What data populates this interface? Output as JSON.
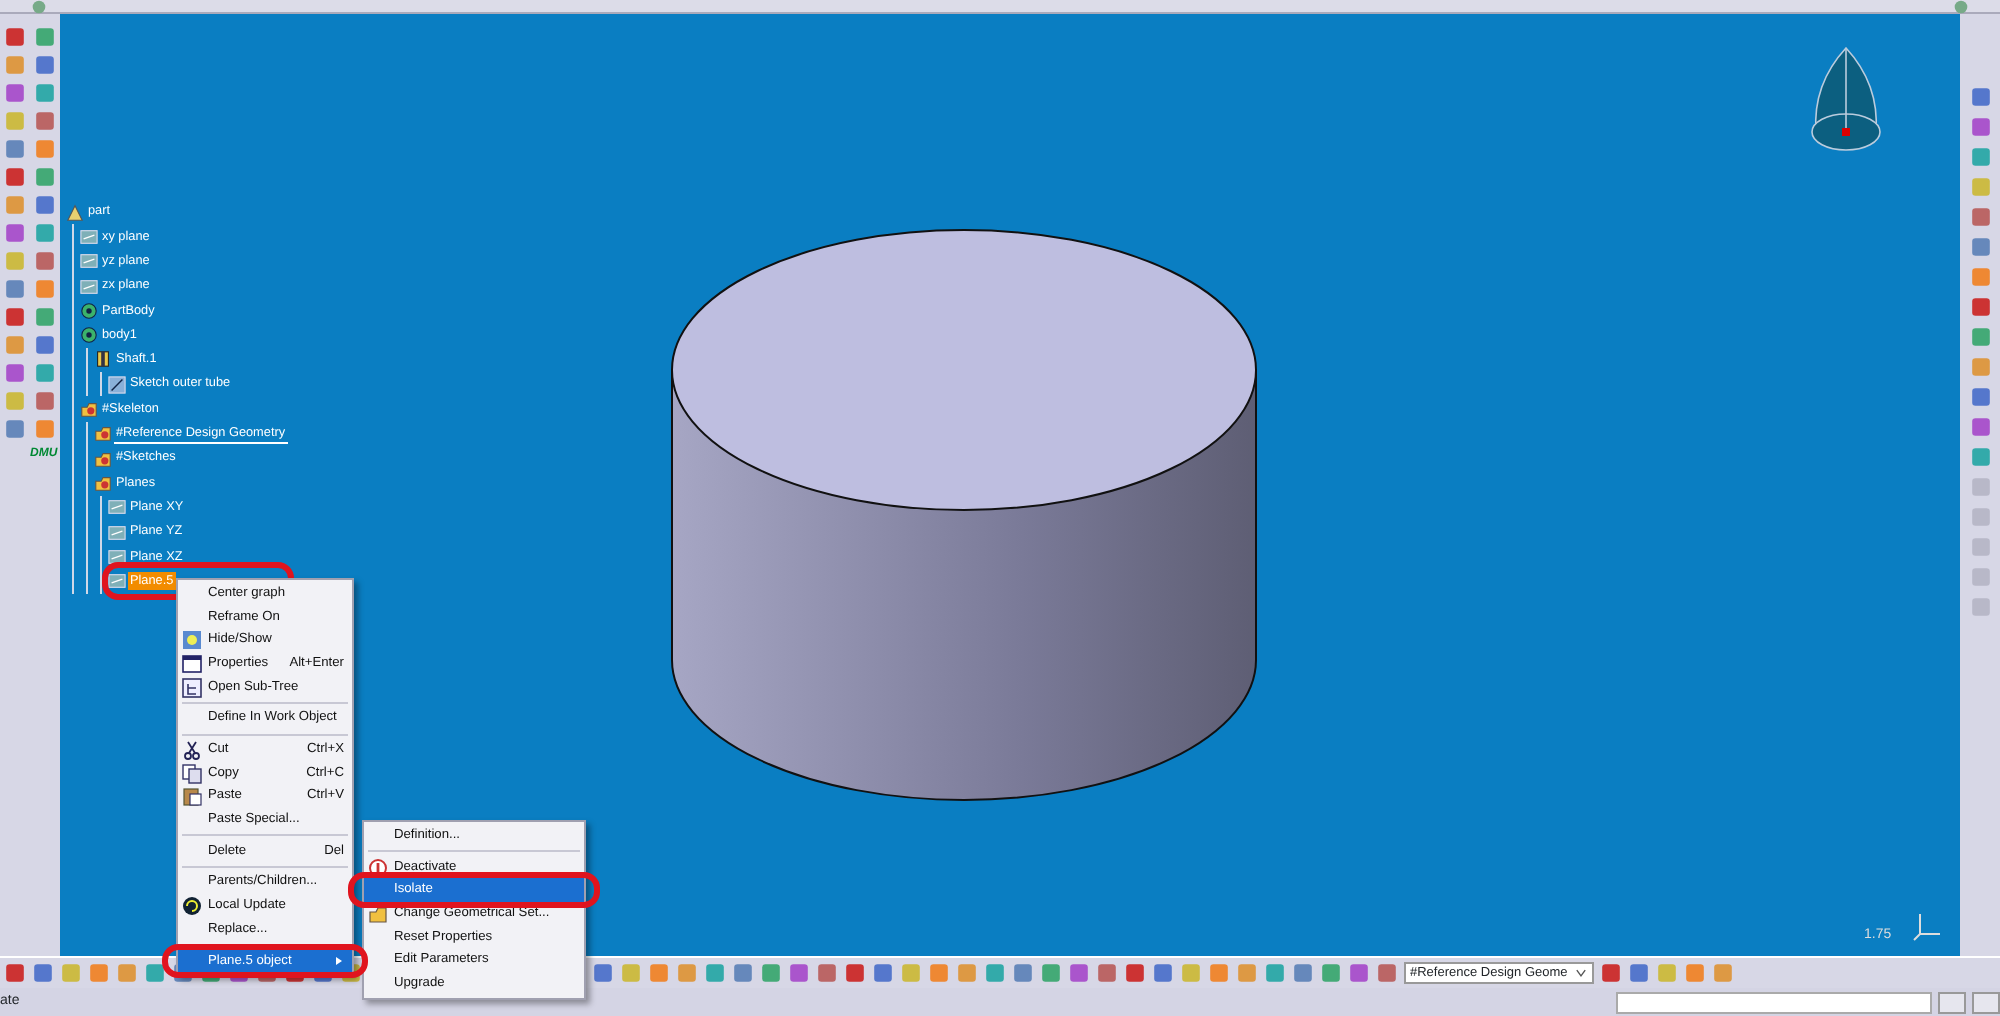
{
  "tree": [
    {
      "label": "part",
      "kind": "part",
      "selected": false,
      "highlight": false,
      "underlined": false,
      "children": [
        {
          "label": "xy plane",
          "kind": "plane",
          "selected": false,
          "highlight": false,
          "underlined": false
        },
        {
          "label": "yz plane",
          "kind": "plane",
          "selected": false,
          "highlight": false,
          "underlined": false
        },
        {
          "label": "zx plane",
          "kind": "plane",
          "selected": false,
          "highlight": false,
          "underlined": false
        },
        {
          "label": "PartBody",
          "kind": "body",
          "selected": false,
          "highlight": false,
          "underlined": false
        },
        {
          "label": "body1",
          "kind": "body",
          "selected": false,
          "highlight": false,
          "underlined": false,
          "children": [
            {
              "label": "Shaft.1",
              "kind": "feature",
              "selected": false,
              "highlight": false,
              "underlined": false,
              "children": [
                {
                  "label": "Sketch outer tube",
                  "kind": "sketch",
                  "selected": false,
                  "highlight": false,
                  "underlined": false
                }
              ]
            }
          ]
        },
        {
          "label": "#Skeleton",
          "kind": "set",
          "selected": false,
          "highlight": false,
          "underlined": false,
          "children": [
            {
              "label": "#Reference Design Geometry",
              "kind": "set",
              "selected": false,
              "highlight": false,
              "underlined": true
            },
            {
              "label": "#Sketches",
              "kind": "set",
              "selected": false,
              "highlight": false,
              "underlined": false
            },
            {
              "label": "Planes",
              "kind": "set",
              "selected": false,
              "highlight": false,
              "underlined": false,
              "children": [
                {
                  "label": "Plane XY",
                  "kind": "plane",
                  "selected": false,
                  "highlight": false,
                  "underlined": false
                },
                {
                  "label": "Plane YZ",
                  "kind": "plane",
                  "selected": false,
                  "highlight": false,
                  "underlined": false
                },
                {
                  "label": "Plane XZ",
                  "kind": "plane",
                  "selected": false,
                  "highlight": false,
                  "underlined": false
                },
                {
                  "label": "Plane.5",
                  "kind": "plane",
                  "selected": true,
                  "highlight": true,
                  "underlined": false
                }
              ]
            }
          ]
        }
      ]
    }
  ],
  "context_menu": [
    {
      "kind": "item",
      "label": "Center graph",
      "selected": false,
      "highlight": false
    },
    {
      "kind": "item",
      "label": "Reframe On",
      "selected": false,
      "highlight": false
    },
    {
      "kind": "hideshow",
      "label": "Hide/Show",
      "selected": false,
      "highlight": false
    },
    {
      "kind": "properties",
      "label": "Properties",
      "shortcut": "Alt+Enter",
      "selected": false,
      "highlight": false
    },
    {
      "kind": "subtree",
      "label": "Open Sub-Tree",
      "selected": false,
      "highlight": false
    },
    {
      "kind": "separator"
    },
    {
      "kind": "item",
      "label": "Define In Work Object",
      "selected": false,
      "highlight": false
    },
    {
      "kind": "separator"
    },
    {
      "kind": "cut",
      "label": "Cut",
      "shortcut": "Ctrl+X",
      "selected": false,
      "highlight": false
    },
    {
      "kind": "copy",
      "label": "Copy",
      "shortcut": "Ctrl+C",
      "selected": false,
      "highlight": false
    },
    {
      "kind": "paste",
      "label": "Paste",
      "shortcut": "Ctrl+V",
      "selected": false,
      "highlight": false
    },
    {
      "kind": "item",
      "label": "Paste Special...",
      "selected": false,
      "highlight": false
    },
    {
      "kind": "separator"
    },
    {
      "kind": "item",
      "label": "Delete",
      "shortcut": "Del",
      "selected": false,
      "highlight": false
    },
    {
      "kind": "separator"
    },
    {
      "kind": "item",
      "label": "Parents/Children...",
      "selected": false,
      "highlight": false
    },
    {
      "kind": "update",
      "label": "Local Update",
      "selected": false,
      "highlight": false
    },
    {
      "kind": "item",
      "label": "Replace...",
      "selected": false,
      "highlight": false
    },
    {
      "kind": "separator"
    },
    {
      "kind": "submenu",
      "label": "Plane.5 object",
      "selected": true,
      "highlight": true
    }
  ],
  "submenu": [
    {
      "kind": "item",
      "label": "Definition...",
      "selected": false,
      "highlight": false
    },
    {
      "kind": "separator"
    },
    {
      "kind": "deactivate",
      "label": "Deactivate",
      "selected": false,
      "highlight": false
    },
    {
      "kind": "item",
      "label": "Isolate",
      "selected": true,
      "highlight": true
    },
    {
      "kind": "changeset",
      "label": "Change Geometrical Set...",
      "selected": false,
      "highlight": false
    },
    {
      "kind": "item",
      "label": "Reset Properties",
      "selected": false,
      "highlight": false
    },
    {
      "kind": "item",
      "label": "Edit Parameters",
      "selected": false,
      "highlight": false
    },
    {
      "kind": "item",
      "label": "Upgrade",
      "selected": false,
      "highlight": false
    }
  ],
  "left_toolbar": {
    "dmu_label": "DMU"
  },
  "viewport": {
    "scale": "1.75"
  },
  "bottom_toolbar": {
    "set_dropdown": "#Reference Design Geome"
  },
  "status_bar": {
    "message": "ate"
  }
}
